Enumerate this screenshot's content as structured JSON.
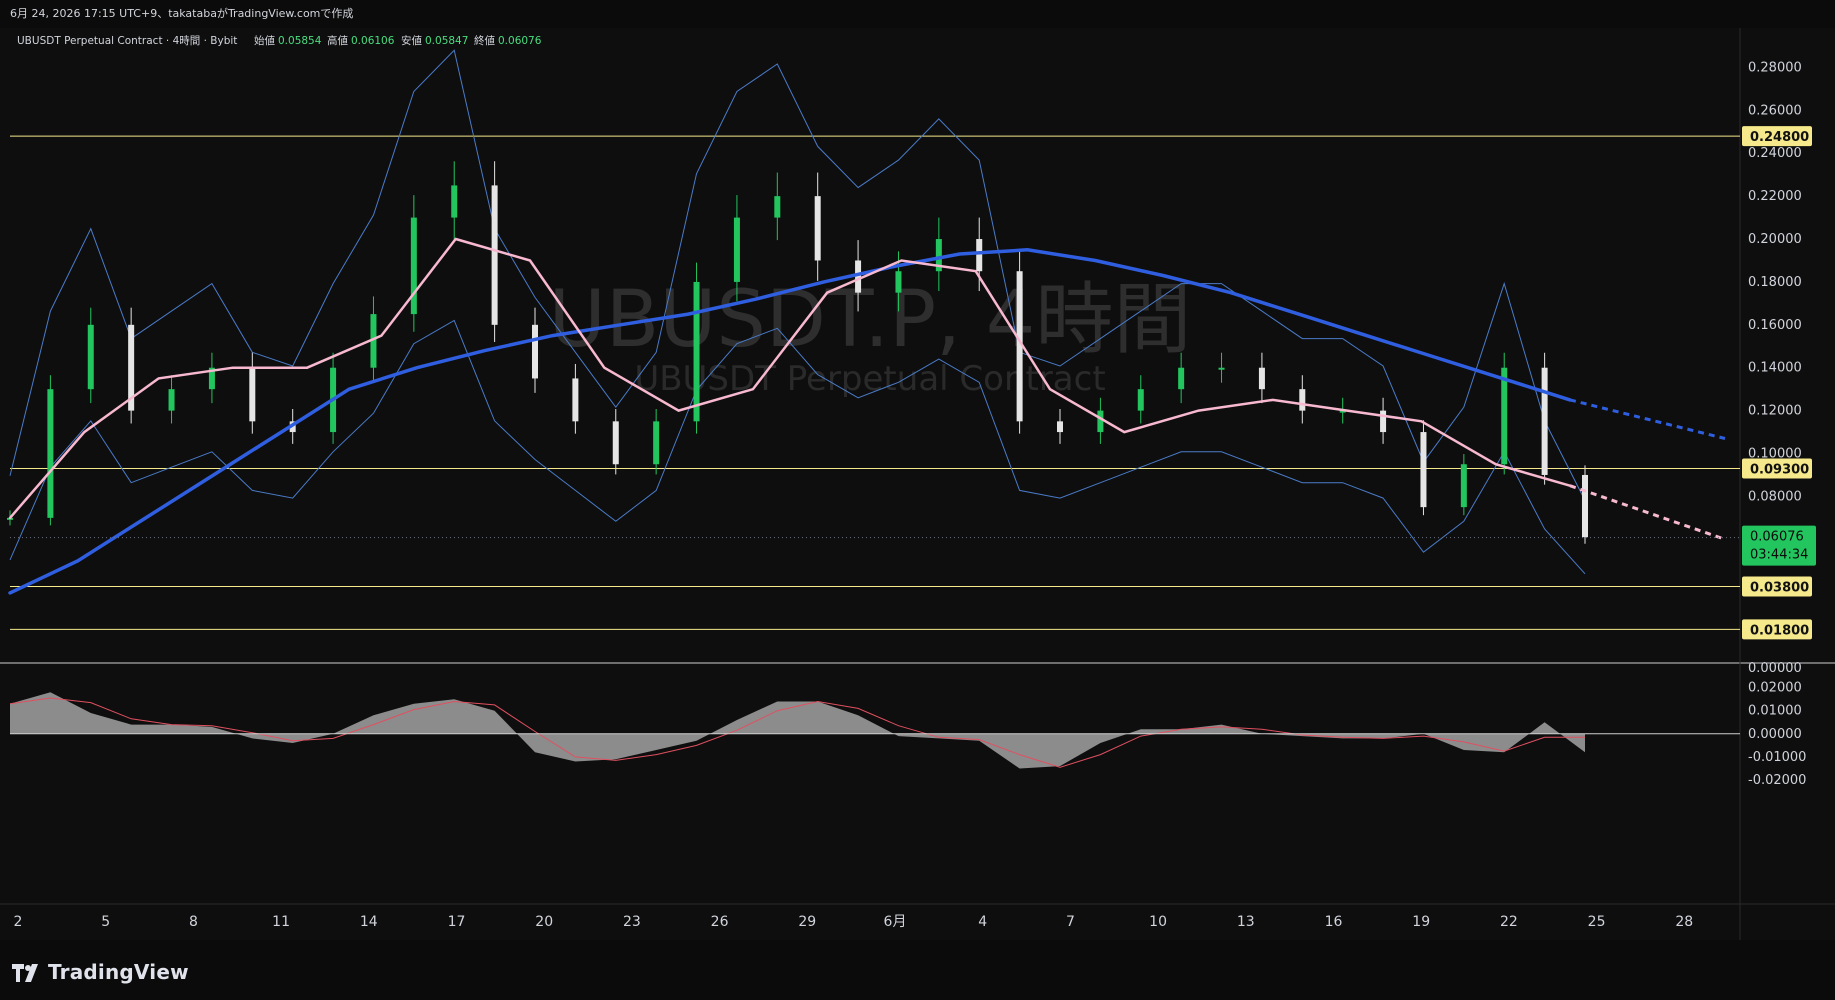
{
  "header": {
    "caption": "6月 24, 2026 17:15 UTC+9、takatabaがTradingView.comで作成"
  },
  "legend": {
    "symbol": "UBUSDT Perpetual Contract · 4時間 · Bybit",
    "open_label": "始値",
    "open_value": "0.05854",
    "high_label": "高値",
    "high_value": "0.06106",
    "low_label": "安値",
    "low_value": "0.05847",
    "close_label": "終値",
    "close_value": "0.06076"
  },
  "watermark": {
    "big": "UBUSDT.P, 4時間",
    "small": "UBUSDT Perpetual Contract"
  },
  "price_axis": {
    "ticks": [
      "0.28000",
      "0.26000",
      "0.24000",
      "0.22000",
      "0.20000",
      "0.18000",
      "0.16000",
      "0.14000",
      "0.12000",
      "0.10000",
      "0.08000",
      "0.00000"
    ],
    "current_price": "0.06076",
    "countdown": "03:44:34"
  },
  "macd_axis": {
    "ticks": [
      "0.02000",
      "0.01000",
      "0.00000",
      "-0.01000",
      "-0.02000"
    ]
  },
  "time_axis": {
    "ticks": [
      "2",
      "5",
      "8",
      "11",
      "14",
      "17",
      "20",
      "23",
      "26",
      "29",
      "6月",
      "4",
      "7",
      "10",
      "13",
      "16",
      "19",
      "22",
      "25",
      "28"
    ]
  },
  "levels": [
    {
      "value": 0.248,
      "label": "0.24800"
    },
    {
      "value": 0.093,
      "label": "0.09300"
    },
    {
      "value": 0.038,
      "label": "0.03800"
    },
    {
      "value": 0.018,
      "label": "0.01800"
    }
  ],
  "colors": {
    "background": "#0e0e0e",
    "up": "#22c55e",
    "down": "#e5e5e5",
    "level": "#f5e98c",
    "ma_blue": "#2f5fe0",
    "ma_pink": "#f7b8d0",
    "ma_green": "#8fd19e",
    "bollinger": "#4a7bc8",
    "fast_line": "#c58bd8",
    "macd_hist": "#8c8c8c",
    "macd_signal": "#e05060"
  },
  "branding": {
    "logo": "TradingView"
  },
  "chart_data": {
    "type": "line",
    "x_labels": [
      "2",
      "5",
      "8",
      "11",
      "14",
      "17",
      "20",
      "23",
      "26",
      "29",
      "6月",
      "4",
      "7",
      "10",
      "13",
      "16",
      "19",
      "22",
      "25",
      "28"
    ],
    "ylim": [
      0.0,
      0.29
    ],
    "grid": false,
    "series": [
      {
        "values": [
          0.07,
          0.13,
          0.16,
          0.12,
          0.13,
          0.14,
          0.115,
          0.11,
          0.14,
          0.165,
          0.21,
          0.225,
          0.16,
          0.135,
          0.115,
          0.095,
          0.115,
          0.18,
          0.21,
          0.22,
          0.19,
          0.175,
          0.185,
          0.2,
          0.185,
          0.115,
          0.11,
          0.12,
          0.13,
          0.14,
          0.14,
          0.13,
          0.12,
          0.12,
          0.11,
          0.075,
          0.095,
          0.14,
          0.09,
          0.061
        ]
      },
      {
        "values": [
          0.035,
          0.05,
          0.07,
          0.09,
          0.11,
          0.13,
          0.14,
          0.148,
          0.155,
          0.16,
          0.165,
          0.172,
          0.18,
          0.187,
          0.193,
          0.195,
          0.19,
          0.183,
          0.175,
          0.165,
          0.155,
          0.145,
          0.135,
          0.125
        ]
      },
      {
        "values": [
          0.07,
          0.11,
          0.135,
          0.14,
          0.14,
          0.155,
          0.2,
          0.19,
          0.14,
          0.12,
          0.13,
          0.175,
          0.19,
          0.185,
          0.13,
          0.11,
          0.12,
          0.125,
          0.12,
          0.115,
          0.095,
          0.085
        ]
      }
    ],
    "macd": {
      "ylim": [
        -0.02,
        0.022
      ],
      "values": [
        0.013,
        0.018,
        0.009,
        0.004,
        0.004,
        0.003,
        -0.002,
        -0.004,
        0.0,
        0.008,
        0.013,
        0.015,
        0.01,
        -0.008,
        -0.012,
        -0.011,
        -0.007,
        -0.003,
        0.006,
        0.014,
        0.014,
        0.008,
        -0.001,
        -0.002,
        -0.003,
        -0.015,
        -0.014,
        -0.004,
        0.002,
        0.002,
        0.004,
        0.0,
        -0.001,
        -0.002,
        -0.002,
        0.0,
        -0.007,
        -0.008,
        0.005,
        -0.008
      ]
    }
  }
}
